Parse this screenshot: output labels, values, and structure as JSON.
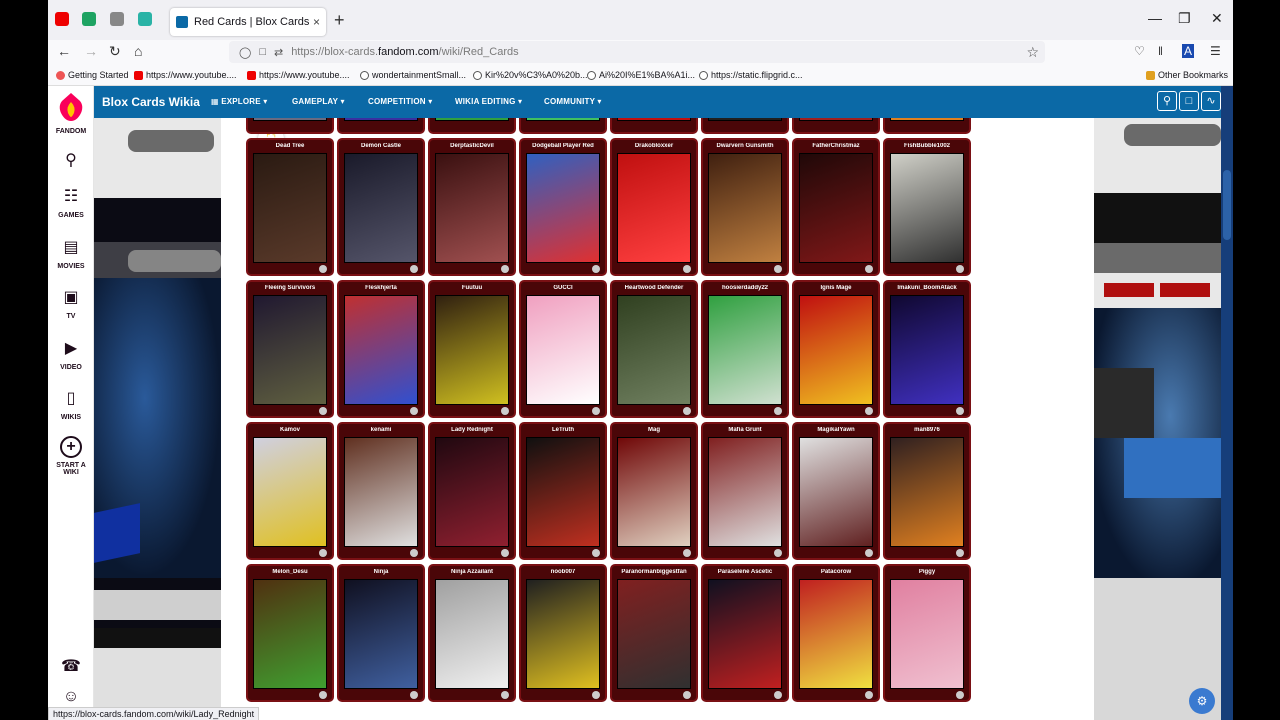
{
  "browser": {
    "tab_title": "Red Cards | Blox Cards Wikia | F",
    "tab_close": "×",
    "new_tab": "+",
    "url_prefix": "https://blox-cards.",
    "url_domain": "fandom.com",
    "url_path": "/wiki/Red_Cards",
    "status_url": "https://blox-cards.fandom.com/wiki/Lady_Rednight"
  },
  "bookmarks": [
    {
      "label": "Getting Started",
      "icon": "firefox"
    },
    {
      "label": "https://www.youtube....",
      "icon": "youtube"
    },
    {
      "label": "https://www.youtube....",
      "icon": "youtube"
    },
    {
      "label": "wondertainmentSmall...",
      "icon": "globe"
    },
    {
      "label": "Kir%20v%C3%A0%20b...",
      "icon": "globe"
    },
    {
      "label": "Ai%20I%E1%BA%A1i...",
      "icon": "globe"
    },
    {
      "label": "https://static.flipgrid.c...",
      "icon": "globe"
    }
  ],
  "other_bookmarks": "Other Bookmarks",
  "fandom": {
    "logo_text": "FANDOM",
    "sidebar": [
      {
        "label": "GAMES",
        "icon": "gamepad-icon"
      },
      {
        "label": "MOVIES",
        "icon": "film-icon"
      },
      {
        "label": "TV",
        "icon": "tv-icon"
      },
      {
        "label": "VIDEO",
        "icon": "video-icon"
      },
      {
        "label": "WIKIS",
        "icon": "book-icon"
      },
      {
        "label": "START A WIKI",
        "icon": "plus-circle-icon"
      }
    ]
  },
  "wiki": {
    "title": "Blox Cards Wikia",
    "nav": [
      "EXPLORE",
      "GAMEPLAY",
      "COMPETITION",
      "WIKIA EDITING",
      "COMMUNITY"
    ]
  },
  "cards": [
    {
      "name": "Dead Tree",
      "art": [
        "#2a1a12",
        "#5a3a2a"
      ]
    },
    {
      "name": "Demon Castle",
      "art": [
        "#1a1a2a",
        "#55556a"
      ]
    },
    {
      "name": "DerptasticDevil",
      "art": [
        "#3a1010",
        "#a05050"
      ]
    },
    {
      "name": "Dodgeball Player Red",
      "art": [
        "#3060c0",
        "#e03030"
      ]
    },
    {
      "name": "Drakobloxxer",
      "art": [
        "#c01010",
        "#ff4040"
      ]
    },
    {
      "name": "Dwarvern Gunsmith",
      "art": [
        "#402010",
        "#c08040"
      ]
    },
    {
      "name": "FatherChristmaz",
      "art": [
        "#200808",
        "#801818"
      ]
    },
    {
      "name": "FishBubble1002",
      "art": [
        "#d0d0c8",
        "#303030"
      ]
    },
    {
      "name": "Fleeing Survivors",
      "art": [
        "#201830",
        "#606040"
      ]
    },
    {
      "name": "Fleskhjerta",
      "art": [
        "#c03030",
        "#3050d0"
      ]
    },
    {
      "name": "Fuutuu",
      "art": [
        "#302010",
        "#d0c020"
      ]
    },
    {
      "name": "GUCCI",
      "art": [
        "#f0a0c0",
        "#ffffff"
      ]
    },
    {
      "name": "Heartwood Defender",
      "art": [
        "#304020",
        "#708060"
      ]
    },
    {
      "name": "hoosierdaddy22",
      "art": [
        "#30a040",
        "#d0e0d0"
      ]
    },
    {
      "name": "Ignis Mage",
      "art": [
        "#c01010",
        "#f0c020"
      ]
    },
    {
      "name": "Imakuni_BoomAtack",
      "art": [
        "#100830",
        "#4030c0"
      ]
    },
    {
      "name": "Kamov",
      "art": [
        "#d0d0e0",
        "#e0c020"
      ]
    },
    {
      "name": "kenami",
      "art": [
        "#603020",
        "#e0e0e0"
      ]
    },
    {
      "name": "Lady Rednight",
      "art": [
        "#200810",
        "#902030"
      ]
    },
    {
      "name": "LeTruth",
      "art": [
        "#101010",
        "#c03020"
      ]
    },
    {
      "name": "Mag",
      "art": [
        "#700808",
        "#e0d0c0"
      ]
    },
    {
      "name": "Mafia Grunt",
      "art": [
        "#802020",
        "#e0e0e0"
      ]
    },
    {
      "name": "MagikalYawn",
      "art": [
        "#e0e0e0",
        "#602020"
      ]
    },
    {
      "name": "man8976",
      "art": [
        "#302020",
        "#e08020"
      ]
    },
    {
      "name": "Melon_Desu",
      "art": [
        "#503010",
        "#40a030"
      ]
    },
    {
      "name": "Ninja",
      "art": [
        "#101020",
        "#4060a0"
      ]
    },
    {
      "name": "Ninja Azzailant",
      "art": [
        "#a0a0a0",
        "#f0f0f0"
      ]
    },
    {
      "name": "noob007",
      "art": [
        "#202020",
        "#e0c020"
      ]
    },
    {
      "name": "Paranormanbiggestfan",
      "art": [
        "#802020",
        "#303030"
      ]
    },
    {
      "name": "Paraselene Ascetic",
      "art": [
        "#101020",
        "#c02020"
      ]
    },
    {
      "name": "Patacorow",
      "art": [
        "#c02020",
        "#f0e040"
      ]
    },
    {
      "name": "Piggy",
      "art": [
        "#e080a0",
        "#f0c0d0"
      ]
    }
  ]
}
